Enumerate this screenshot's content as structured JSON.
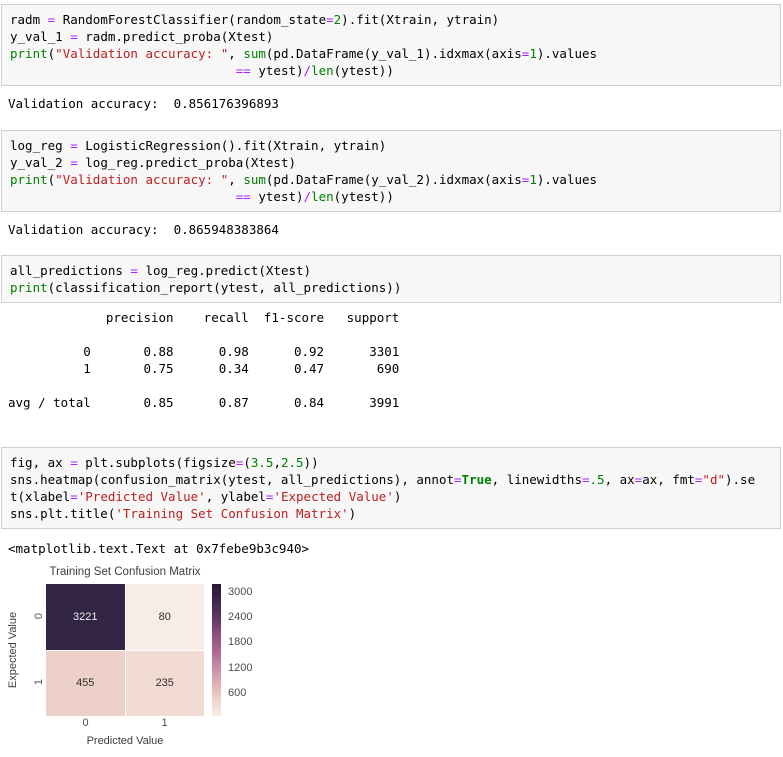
{
  "cells": [
    {
      "lines": [
        [
          {
            "t": "radm "
          },
          {
            "t": "=",
            "c": "op"
          },
          {
            "t": " RandomForestClassifier(random_state"
          },
          {
            "t": "=",
            "c": "op"
          },
          {
            "t": "2",
            "c": "num"
          },
          {
            "t": ").fit(Xtrain, ytrain)"
          }
        ],
        [
          {
            "t": "y_val_1 "
          },
          {
            "t": "=",
            "c": "op"
          },
          {
            "t": " radm.predict_proba(Xtest)"
          }
        ],
        [
          {
            "t": "print",
            "c": "bi"
          },
          {
            "t": "("
          },
          {
            "t": "\"Validation accuracy: \"",
            "c": "str"
          },
          {
            "t": ", "
          },
          {
            "t": "sum",
            "c": "bi"
          },
          {
            "t": "(pd.DataFrame(y_val_1).idxmax(axis"
          },
          {
            "t": "=",
            "c": "op"
          },
          {
            "t": "1",
            "c": "num"
          },
          {
            "t": ").values"
          }
        ],
        [
          {
            "t": "                              "
          },
          {
            "t": "==",
            "c": "op"
          },
          {
            "t": " ytest)"
          },
          {
            "t": "/",
            "c": "op"
          },
          {
            "t": "len",
            "c": "bi"
          },
          {
            "t": "(ytest))"
          }
        ]
      ],
      "output": "Validation accuracy:  0.856176396893"
    },
    {
      "lines": [
        [
          {
            "t": "log_reg "
          },
          {
            "t": "=",
            "c": "op"
          },
          {
            "t": " LogisticRegression().fit(Xtrain, ytrain)"
          }
        ],
        [
          {
            "t": "y_val_2 "
          },
          {
            "t": "=",
            "c": "op"
          },
          {
            "t": " log_reg.predict_proba(Xtest)"
          }
        ],
        [
          {
            "t": "print",
            "c": "bi"
          },
          {
            "t": "("
          },
          {
            "t": "\"Validation accuracy: \"",
            "c": "str"
          },
          {
            "t": ", "
          },
          {
            "t": "sum",
            "c": "bi"
          },
          {
            "t": "(pd.DataFrame(y_val_2).idxmax(axis"
          },
          {
            "t": "=",
            "c": "op"
          },
          {
            "t": "1",
            "c": "num"
          },
          {
            "t": ").values"
          }
        ],
        [
          {
            "t": "                              "
          },
          {
            "t": "==",
            "c": "op"
          },
          {
            "t": " ytest)"
          },
          {
            "t": "/",
            "c": "op"
          },
          {
            "t": "len",
            "c": "bi"
          },
          {
            "t": "(ytest))"
          }
        ]
      ],
      "output": "Validation accuracy:  0.865948383864"
    },
    {
      "lines": [
        [
          {
            "t": "all_predictions "
          },
          {
            "t": "=",
            "c": "op"
          },
          {
            "t": " log_reg.predict(Xtest)"
          }
        ],
        [
          {
            "t": "print",
            "c": "bi"
          },
          {
            "t": "(classification_report(ytest, all_predictions))"
          }
        ]
      ],
      "output": "             precision    recall  f1-score   support\n\n          0       0.88      0.98      0.92      3301\n          1       0.75      0.34      0.47       690\n\navg / total       0.85      0.87      0.84      3991\n"
    },
    {
      "lines": [
        [
          {
            "t": "fig, ax "
          },
          {
            "t": "=",
            "c": "op"
          },
          {
            "t": " plt.subplots(figsize"
          },
          {
            "t": "=",
            "c": "op"
          },
          {
            "t": "("
          },
          {
            "t": "3.5",
            "c": "num"
          },
          {
            "t": ","
          },
          {
            "t": "2.5",
            "c": "num"
          },
          {
            "t": "))"
          }
        ],
        [
          {
            "t": "sns.heatmap(confusion_matrix(ytest, all_predictions), annot"
          },
          {
            "t": "=",
            "c": "op"
          },
          {
            "t": "True",
            "c": "kw"
          },
          {
            "t": ", linewidths"
          },
          {
            "t": "=",
            "c": "op"
          },
          {
            "t": ".5",
            "c": "num"
          },
          {
            "t": ", ax"
          },
          {
            "t": "=",
            "c": "op"
          },
          {
            "t": "ax, fmt"
          },
          {
            "t": "=",
            "c": "op"
          },
          {
            "t": "\"d\"",
            "c": "str"
          },
          {
            "t": ").se"
          }
        ],
        [
          {
            "t": "t(xlabel"
          },
          {
            "t": "=",
            "c": "op"
          },
          {
            "t": "'Predicted Value'",
            "c": "str"
          },
          {
            "t": ", ylabel"
          },
          {
            "t": "=",
            "c": "op"
          },
          {
            "t": "'Expected Value'",
            "c": "str"
          },
          {
            "t": ")"
          }
        ],
        [
          {
            "t": "sns.plt.title("
          },
          {
            "t": "'Training Set Confusion Matrix'",
            "c": "str"
          },
          {
            "t": ")"
          }
        ]
      ],
      "output": "<matplotlib.text.Text at 0x7febe9b3c940>"
    }
  ],
  "chart_data": {
    "type": "heatmap",
    "title": "Training Set Confusion Matrix",
    "xlabel": "Predicted Value",
    "ylabel": "Expected Value",
    "x_ticklabels": [
      "0",
      "1"
    ],
    "y_ticklabels": [
      "0",
      "1"
    ],
    "matrix": [
      [
        3221,
        80
      ],
      [
        455,
        235
      ]
    ],
    "colorbar_ticks": [
      "3000",
      "2400",
      "1800",
      "1200",
      "600"
    ],
    "colorbar_range": [
      80,
      3221
    ],
    "legend_position": "colorbar-right",
    "grid": false,
    "cell_colors": [
      [
        "#322443",
        "#f8ece7"
      ],
      [
        "#edd0c8",
        "#f2dbd3"
      ]
    ],
    "cell_text_colors": [
      [
        "#efecf1",
        "#2e2e2e"
      ],
      [
        "#2e2e2e",
        "#2e2e2e"
      ]
    ],
    "colorbar_gradient": [
      "#271935",
      "#3d2749",
      "#5c3560",
      "#8a4f7d",
      "#ab6590",
      "#c88ba6",
      "#ddb0b4",
      "#eed3cb",
      "#f9ece7"
    ]
  },
  "style_colors": {
    "cell_background": "#f7f7f7",
    "cell_border": "#cfcfcf",
    "string": "#BA2121",
    "builtin": "#008000",
    "operator": "#AA22FF"
  }
}
